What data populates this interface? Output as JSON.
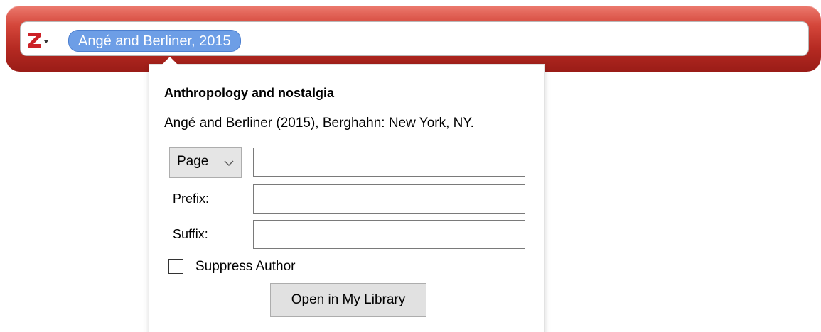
{
  "quick_format": {
    "logo_icon": "zotero-z-icon",
    "citation_bubble": "Angé and Berliner, 2015"
  },
  "popup": {
    "title": "Anthropology and nostalgia",
    "details": "Angé and Berliner (2015), Berghahn: New York, NY.",
    "locator": {
      "selected": "Page",
      "value": ""
    },
    "prefix": {
      "label": "Prefix:",
      "value": ""
    },
    "suffix": {
      "label": "Suffix:",
      "value": ""
    },
    "suppress_author": {
      "label": "Suppress Author",
      "checked": false
    },
    "open_button": "Open in My Library"
  },
  "colors": {
    "bar_red": "#b52a22",
    "bubble_blue": "#6d9ee6",
    "logo_red": "#cc2127"
  }
}
